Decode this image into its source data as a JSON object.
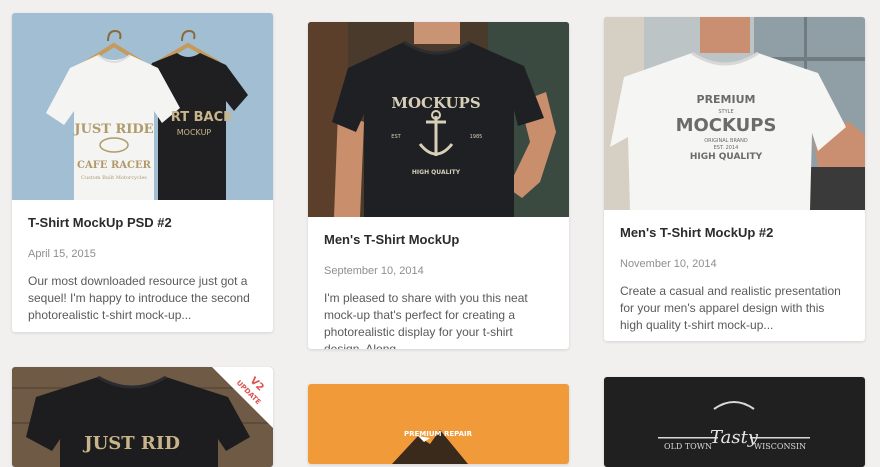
{
  "cards": [
    {
      "title": "T-Shirt MockUp PSD #2",
      "date": "April 15, 2015",
      "excerpt": "Our most downloaded resource just got a sequel! I'm happy to introduce the second photorealistic t-shirt mock-up...",
      "art": {
        "front_line1": "JUST RIDE",
        "front_line2": "CAFE RACER",
        "front_line3": "Custom Built Motorcycles",
        "back_line1": "RT BACK",
        "back_line2": "MOCKUP"
      }
    },
    {
      "title": "Men's T-Shirt MockUp",
      "date": "September 10, 2014",
      "excerpt": "I'm pleased to share with you this neat mock-up that's perfect for creating a photorealistic display for your t-shirt design. Along...",
      "art": {
        "line1": "MOCKUPS",
        "line2": "HIGH QUALITY",
        "est": "EST",
        "year": "1985"
      }
    },
    {
      "title": "Men's T-Shirt MockUp #2",
      "date": "November 10, 2014",
      "excerpt": "Create a casual and realistic presentation for your men's apparel design with this high quality t-shirt mock-up...",
      "art": {
        "line1": "PREMIUM",
        "line2": "STYLE",
        "line3": "MOCKUPS",
        "line4": "ORIGINAL BRAND",
        "line5": "EST. 2014",
        "line6": "HIGH QUALITY"
      }
    },
    {
      "art": {
        "shirt_text": "JUST RID",
        "ribbon_line1": "V2",
        "ribbon_line2": "UPDATE"
      }
    },
    {
      "art": {
        "text": "PREMIUM REPAIR"
      }
    },
    {
      "art": {
        "left": "OLD TOWN",
        "script": "Tasty",
        "right": "WISCONSIN"
      }
    }
  ],
  "colors": {
    "accent_red": "#d9534f",
    "card_bg": "#ffffff",
    "page_bg": "#f1f0ef"
  }
}
